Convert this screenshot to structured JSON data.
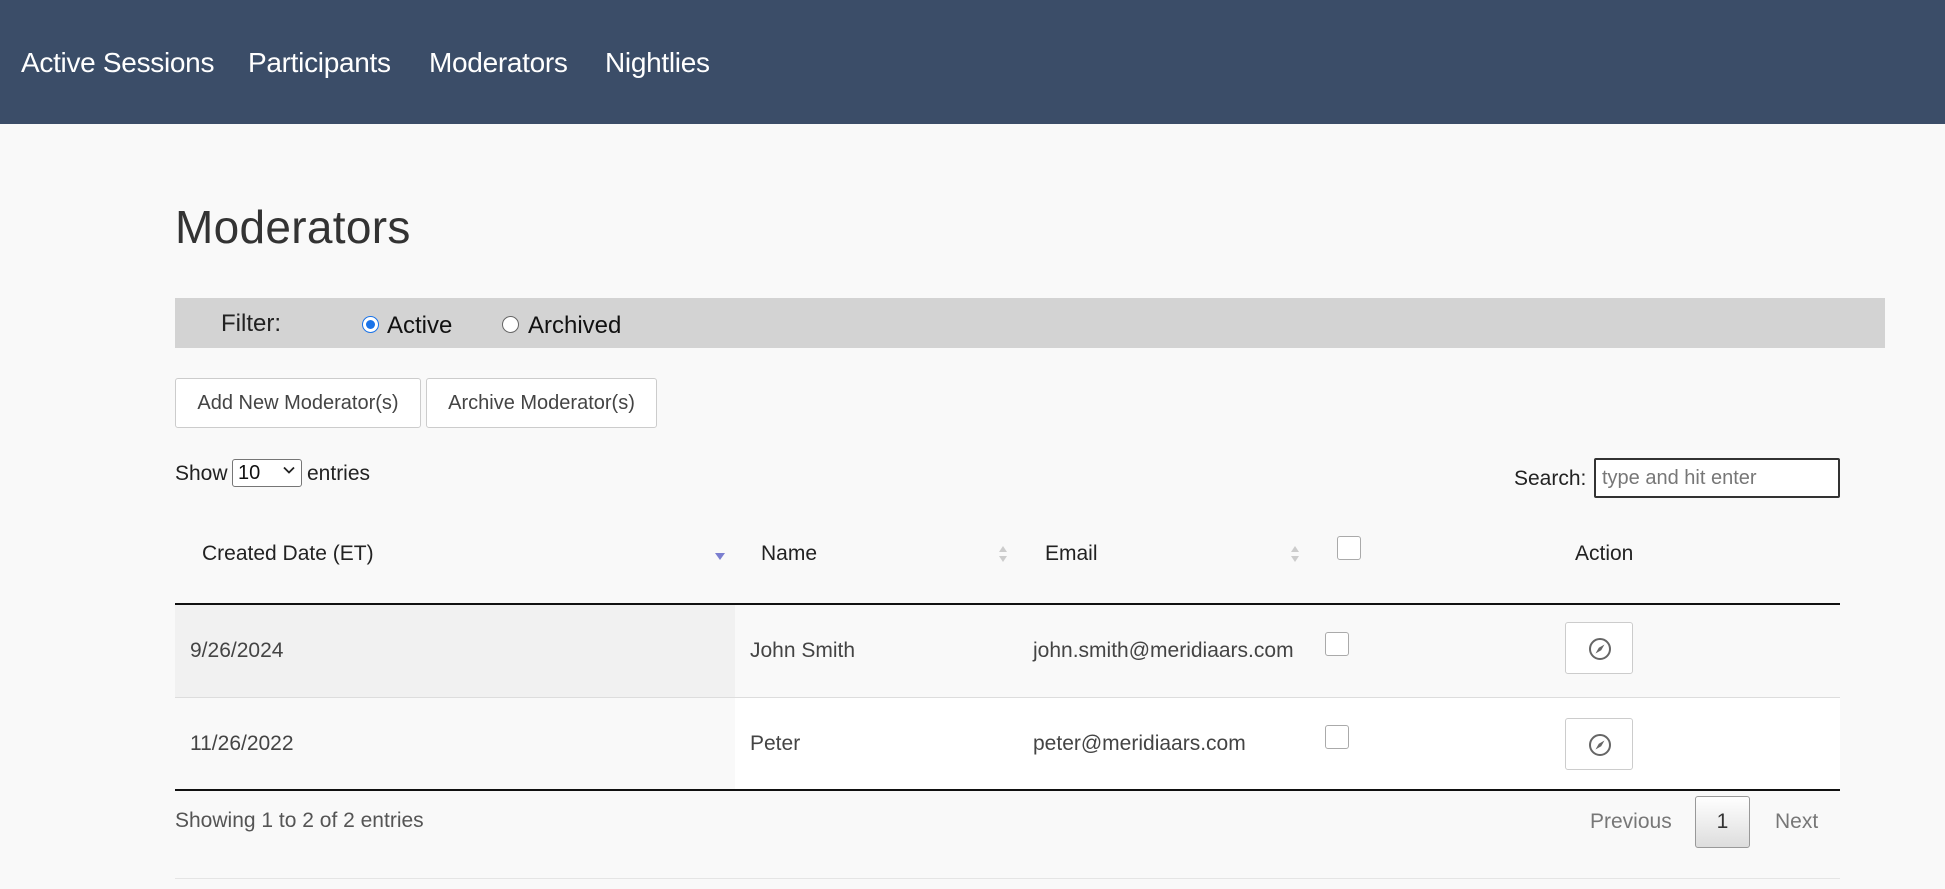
{
  "nav": {
    "items": [
      "Active Sessions",
      "Participants",
      "Moderators",
      "Nightlies"
    ]
  },
  "page": {
    "title": "Moderators"
  },
  "filter": {
    "label": "Filter:",
    "options": [
      {
        "label": "Active",
        "checked": true
      },
      {
        "label": "Archived",
        "checked": false
      }
    ]
  },
  "toolbar": {
    "add_label": "Add New Moderator(s)",
    "archive_label": "Archive Moderator(s)"
  },
  "length": {
    "show": "Show",
    "value": "10",
    "entries": "entries"
  },
  "search": {
    "label": "Search:",
    "placeholder": "type and hit enter"
  },
  "table": {
    "columns": [
      "Created Date (ET)",
      "Name",
      "Email",
      "Action"
    ],
    "rows": [
      {
        "date": "9/26/2024",
        "name": "John Smith",
        "email": "john.smith@meridiaars.com"
      },
      {
        "date": "11/26/2022",
        "name": "Peter",
        "email": "peter@meridiaars.com"
      }
    ]
  },
  "footer": {
    "info": "Showing 1 to 2 of 2 entries",
    "previous": "Previous",
    "page": "1",
    "next": "Next"
  },
  "colors": {
    "nav_bg": "#3b4d68",
    "filter_bg": "#d3d3d3",
    "sort_active": "#7b7fd0"
  },
  "icons": {
    "sort": "sort-arrows-icon",
    "action": "compass-icon",
    "select": "chevron-down-icon"
  }
}
